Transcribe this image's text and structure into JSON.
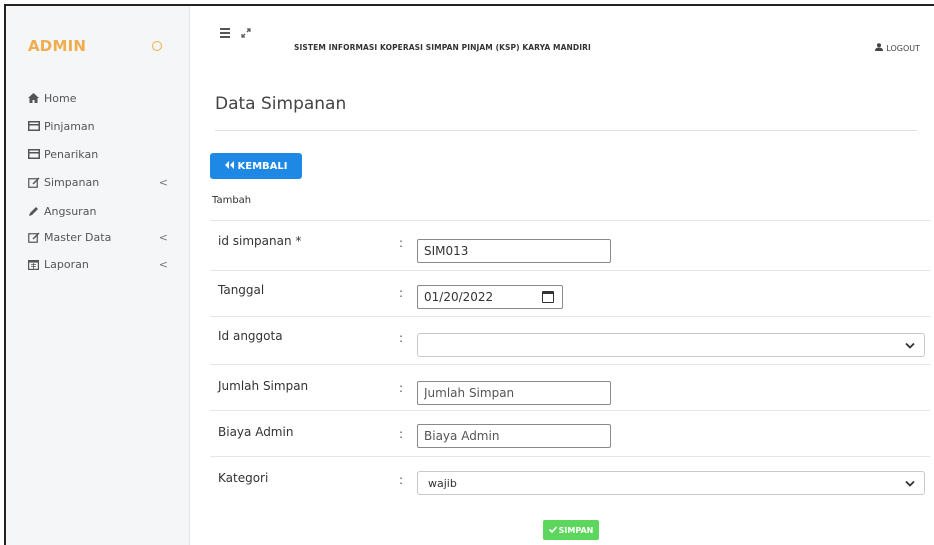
{
  "sidebar": {
    "brand": "ADMIN",
    "items": [
      {
        "label": "Home",
        "icon": "home-icon"
      },
      {
        "label": "Pinjaman",
        "icon": "card-icon"
      },
      {
        "label": "Penarikan",
        "icon": "card-icon"
      },
      {
        "label": "Simpanan",
        "icon": "edit-icon",
        "chevron": "<"
      },
      {
        "label": "Angsuran",
        "icon": "pencil-icon"
      },
      {
        "label": "Master Data",
        "icon": "edit-icon",
        "chevron": "<"
      },
      {
        "label": "Laporan",
        "icon": "calendar-icon",
        "chevron": "<"
      }
    ]
  },
  "header": {
    "system_title": "SISTEM INFORMASI KOPERASI SIMPAN PINJAM (KSP) KARYA MANDIRI",
    "logout_label": "LOGOUT"
  },
  "main": {
    "page_title": "Data Simpanan",
    "back_button": "KEMBALI",
    "sub_label": "Tambah",
    "form": {
      "id_simpanan": {
        "label": "id simpanan *",
        "value": "SIM013"
      },
      "tanggal": {
        "label": "Tanggal",
        "value": "01/20/2022"
      },
      "id_anggota": {
        "label": "Id anggota",
        "value": ""
      },
      "jumlah_simpan": {
        "label": "Jumlah Simpan",
        "placeholder": "Jumlah Simpan"
      },
      "biaya_admin": {
        "label": "Biaya Admin",
        "placeholder": "Biaya Admin"
      },
      "kategori": {
        "label": "Kategori",
        "value": "wajib"
      },
      "colon": ":"
    },
    "save_button": "SIMPAN"
  },
  "colors": {
    "brand": "#f0ad4e",
    "primary": "#1e88e5",
    "success": "#5cd65c",
    "sidebar_bg": "#f4f6f8"
  }
}
